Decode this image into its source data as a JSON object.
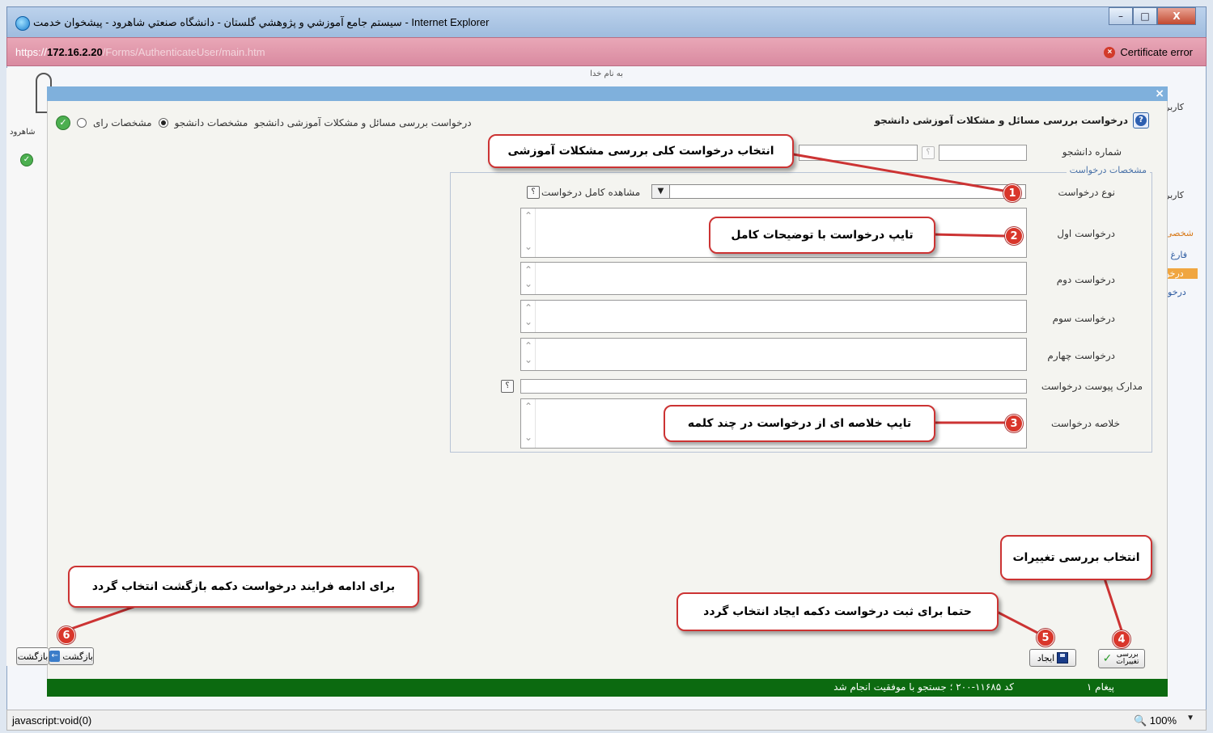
{
  "window": {
    "title": "سیستم جامع آموزشي و پژوهشي گلستان - دانشگاه صنعتي شاهرود - پیشخوان خدمت - Internet Explorer",
    "minimize": "–",
    "maximize": "□",
    "close": "X"
  },
  "address": {
    "scheme": "https://",
    "host": "172.16.2.20",
    "path": "/Forms/AuthenticateUser/main.htm",
    "cert_error": "Certificate error"
  },
  "page_header": "به نام خدا",
  "under_left": {
    "text": "شاهرود"
  },
  "under_right": {
    "items": [
      "کاربر",
      "کاربر",
      "شخصی",
      "فارغ ا",
      "درخو",
      "درخوا"
    ]
  },
  "dialog": {
    "title": "درخواست بررسی مسائل و مشکلات آموزشی دانشجو",
    "close": "×",
    "header_radio": {
      "prefix": "درخواست بررسی مسائل و مشکلات آموزشی دانشجو",
      "option1": "مشخصات دانشجو",
      "option2": "مشخصات رای"
    },
    "student_number_label": "شماره دانشجو",
    "q": "؟",
    "fieldset_legend": "مشخصات درخواست",
    "fields": {
      "request_type": "نوع درخواست",
      "view_full": "مشاهده کامل درخواست",
      "req1": "درخواست اول",
      "req2": "درخواست دوم",
      "req3": "درخواست سوم",
      "req4": "درخواست چهارم",
      "attachments": "مدارک پیوست درخواست",
      "summary": "خلاصه درخواست"
    }
  },
  "callouts": {
    "c1": "انتخاب درخواست کلی بررسی مشکلات آموزشی",
    "c2": "تایپ درخواست با توضیحات کامل",
    "c3": "تایپ خلاصه ای از درخواست در چند کلمه",
    "c4": "انتخاب بررسی تغییرات",
    "c5": "حتما برای ثبت درخواست دکمه ایجاد انتخاب گردد",
    "c6": "برای ادامه فرایند درخواست دکمه بازگشت انتخاب گردد"
  },
  "badges": [
    "1",
    "2",
    "3",
    "4",
    "5",
    "6"
  ],
  "buttons": {
    "review": "بررسی تغییرات",
    "create": "ایجاد",
    "back": "بازگشت",
    "back2": "بازگشت"
  },
  "status": {
    "count": "۱ پیغام",
    "message": "کد ۱۱۶۸۵-۲۰۰ ؛ جستجو با موفقیت انجام شد"
  },
  "ie_status": {
    "left": "javascript:void(0)",
    "zoom": "100%"
  },
  "colors": {
    "accent": "#c33333",
    "status_green": "#0c6a10",
    "dialog_bar": "#7fb0dc"
  }
}
